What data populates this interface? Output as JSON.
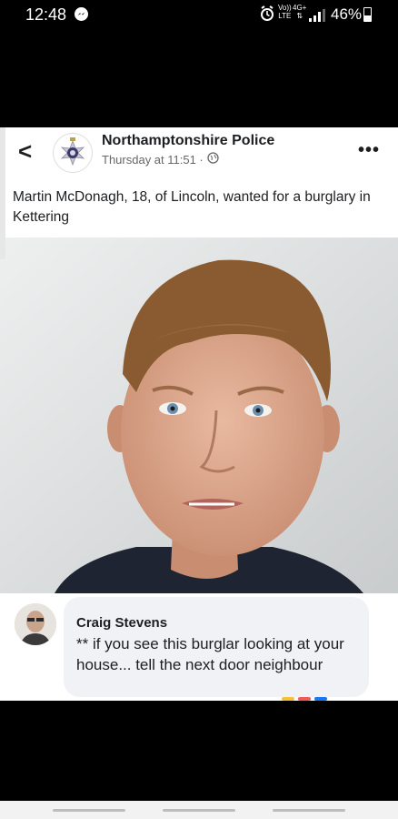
{
  "statusbar": {
    "time": "12:48",
    "volte_top": "Vo))",
    "volte_bottom": "LTE",
    "net_top": "4G+",
    "net_bottom": "⇅",
    "battery_pct": "46%",
    "battery_level": 0.46
  },
  "post": {
    "page_name": "Northamptonshire Police",
    "time": "Thursday at 11:51 ·",
    "text": "Martin McDonagh, 18, of Lincoln, wanted for a burglary in Kettering",
    "icons": {
      "back": "back-chevron-icon",
      "privacy": "globe-icon",
      "more": "more-options-icon"
    }
  },
  "comment": {
    "author": "Craig Stevens",
    "text": "** if you see this burglar looking  at your house... tell the next door neighbour"
  },
  "colors": {
    "reaction_1": "#f5c33b",
    "reaction_2": "#f05a5a",
    "reaction_3": "#1877f2"
  }
}
